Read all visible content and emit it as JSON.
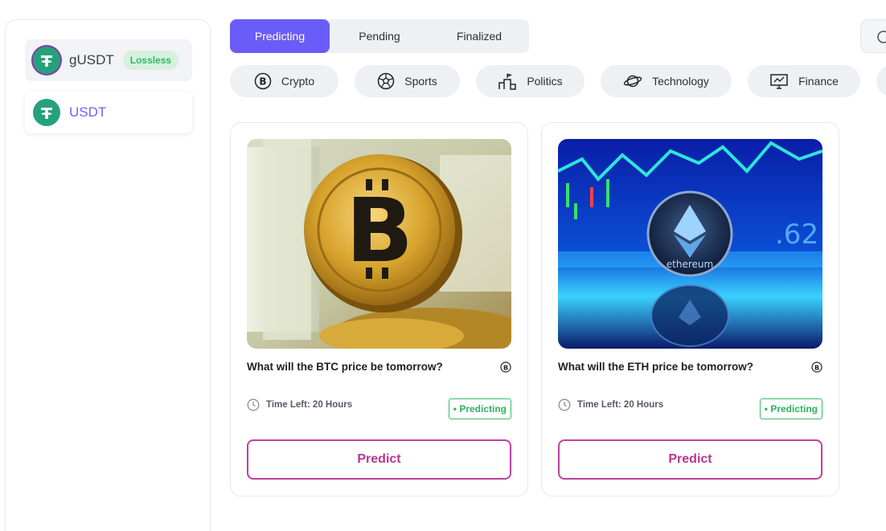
{
  "sidebar": {
    "tokens": [
      {
        "name": "gUSDT",
        "badge": "Lossless",
        "logo": "tether-icon"
      },
      {
        "name": "USDT",
        "logo": "tether-icon"
      }
    ]
  },
  "status_tabs": [
    {
      "label": "Predicting",
      "active": true
    },
    {
      "label": "Pending",
      "active": false
    },
    {
      "label": "Finalized",
      "active": false
    }
  ],
  "categories": [
    {
      "label": "Crypto",
      "icon": "bitcoin-icon"
    },
    {
      "label": "Sports",
      "icon": "soccer-ball-icon"
    },
    {
      "label": "Politics",
      "icon": "podium-icon"
    },
    {
      "label": "Technology",
      "icon": "planet-icon"
    },
    {
      "label": "Finance",
      "icon": "monitor-chart-icon"
    }
  ],
  "cards": [
    {
      "title": "What will the BTC price be tomorrow?",
      "time_left": "Time Left: 20 Hours",
      "status": "• Predicting",
      "button": "Predict",
      "image": "bitcoin-coin-photo"
    },
    {
      "title": "What will the ETH price be tomorrow?",
      "time_left": "Time Left: 20 Hours",
      "status": "• Predicting",
      "button": "Predict",
      "image": "ethereum-coin-photo"
    }
  ],
  "colors": {
    "accent": "#6a5cf6",
    "predict": "#c2409a",
    "status_green": "#3cba6a",
    "tether_green": "#26a17b"
  }
}
